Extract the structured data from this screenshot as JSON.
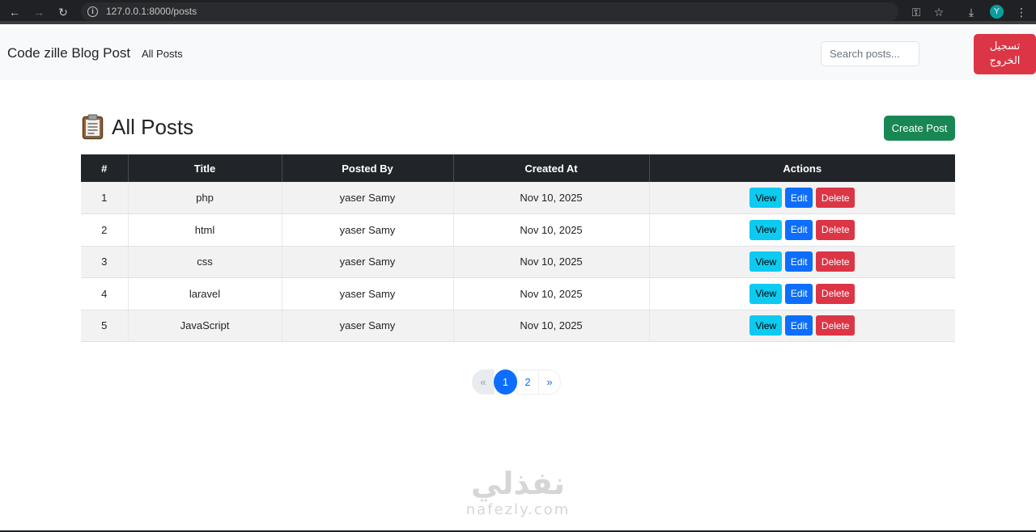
{
  "browser": {
    "url": "127.0.0.1:8000/posts",
    "profile_initial": "Y"
  },
  "navbar": {
    "brand": "Code zille Blog Post",
    "link": "All Posts",
    "search_placeholder": "Search posts...",
    "logout_label": "تسجيل الخروج"
  },
  "header": {
    "title": "All Posts",
    "create_label": "Create Post"
  },
  "table": {
    "columns": [
      "#",
      "Title",
      "Posted By",
      "Created At",
      "Actions"
    ],
    "rows": [
      {
        "num": "1",
        "title": "php",
        "posted_by": "yaser Samy",
        "created_at": "Nov 10, 2025"
      },
      {
        "num": "2",
        "title": "html",
        "posted_by": "yaser Samy",
        "created_at": "Nov 10, 2025"
      },
      {
        "num": "3",
        "title": "css",
        "posted_by": "yaser Samy",
        "created_at": "Nov 10, 2025"
      },
      {
        "num": "4",
        "title": "laravel",
        "posted_by": "yaser Samy",
        "created_at": "Nov 10, 2025"
      },
      {
        "num": "5",
        "title": "JavaScript",
        "posted_by": "yaser Samy",
        "created_at": "Nov 10, 2025"
      }
    ],
    "actions": {
      "view": "View",
      "edit": "Edit",
      "delete": "Delete"
    }
  },
  "pagination": {
    "prev": "«",
    "pages": [
      "1",
      "2"
    ],
    "current": "1",
    "next": "»"
  },
  "watermark": {
    "arabic": "نفذلي",
    "latin": "nafezly.com"
  },
  "colors": {
    "primary": "#0d6efd",
    "success": "#198754",
    "danger": "#dc3545",
    "info": "#0dcaf0",
    "dark": "#212529"
  }
}
